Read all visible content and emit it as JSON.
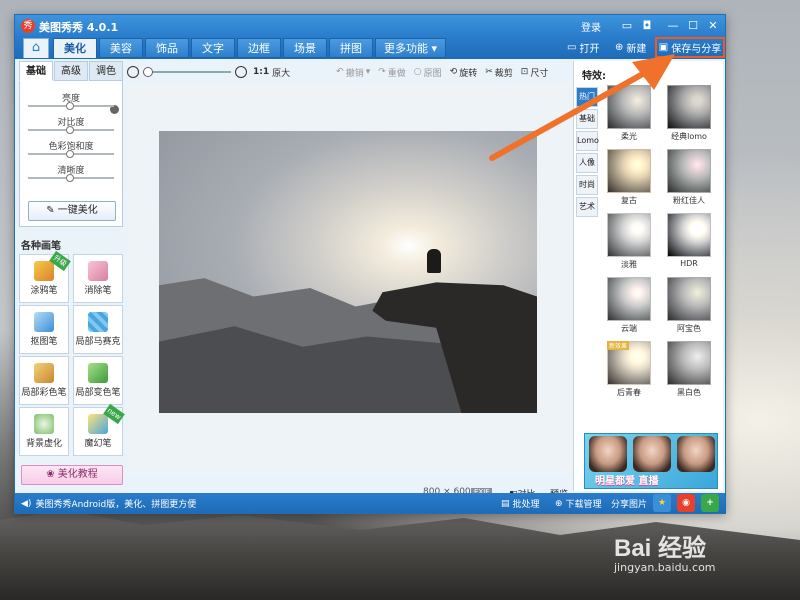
{
  "window": {
    "title": "美图秀秀 4.0.1",
    "login": "登录"
  },
  "tabs": [
    {
      "label": "美化"
    },
    {
      "label": "美容"
    },
    {
      "label": "饰品"
    },
    {
      "label": "文字"
    },
    {
      "label": "边框"
    },
    {
      "label": "场景"
    },
    {
      "label": "拼图"
    }
  ],
  "more_tab": "更多功能",
  "top_actions": {
    "open": "打开",
    "new": "新建",
    "save_share": "保存与分享"
  },
  "left": {
    "sub_tabs": [
      {
        "label": "基础"
      },
      {
        "label": "高级"
      },
      {
        "label": "调色"
      }
    ],
    "adjust": [
      {
        "label": "亮度"
      },
      {
        "label": "对比度"
      },
      {
        "label": "色彩饱和度"
      },
      {
        "label": "清晰度"
      }
    ],
    "one_click": "一键美化",
    "brush_title": "各种画笔",
    "brushes": [
      {
        "label": "涂鸦笔",
        "badge": "升级"
      },
      {
        "label": "消除笔"
      },
      {
        "label": "抠图笔"
      },
      {
        "label": "局部马赛克"
      },
      {
        "label": "局部彩色笔"
      },
      {
        "label": "局部变色笔"
      },
      {
        "label": "背景虚化"
      },
      {
        "label": "魔幻笔",
        "badge": "new"
      }
    ],
    "tutorial": "美化教程"
  },
  "toolbar": {
    "ratio": "1:1",
    "original_size": "原大",
    "undo": "撤销",
    "redo": "重做",
    "original": "原图",
    "rotate": "旋转",
    "crop": "裁剪",
    "resize": "尺寸"
  },
  "canvas": {
    "width": "800",
    "times": "×",
    "height": "600",
    "exif": "EXIF",
    "compare": "对比",
    "preview": "预览"
  },
  "effects": {
    "title": "特效:",
    "categories": [
      {
        "label": "热门"
      },
      {
        "label": "基础"
      },
      {
        "label": "Lomo"
      },
      {
        "label": "人像"
      },
      {
        "label": "时尚"
      },
      {
        "label": "艺术"
      }
    ],
    "items": [
      {
        "label": "柔光"
      },
      {
        "label": "经典lomo"
      },
      {
        "label": "复古"
      },
      {
        "label": "粉红佳人"
      },
      {
        "label": "淡雅"
      },
      {
        "label": "HDR"
      },
      {
        "label": "云端"
      },
      {
        "label": "阿宝色"
      },
      {
        "label": "后青春",
        "badge": "新效果"
      },
      {
        "label": "黑白色"
      }
    ],
    "ad_text": "明星都爱 直播"
  },
  "status": {
    "promo": "美图秀秀Android版，美化、拼图更方便",
    "batch": "批处理",
    "download": "下载管理",
    "share": "分享图片"
  },
  "watermark": {
    "logo": "Bai 经验",
    "url": "jingyan.baidu.com"
  },
  "colors": {
    "accent": "#2a7ccb",
    "highlight": "#f05a22",
    "panel": "#eaf2fa"
  }
}
